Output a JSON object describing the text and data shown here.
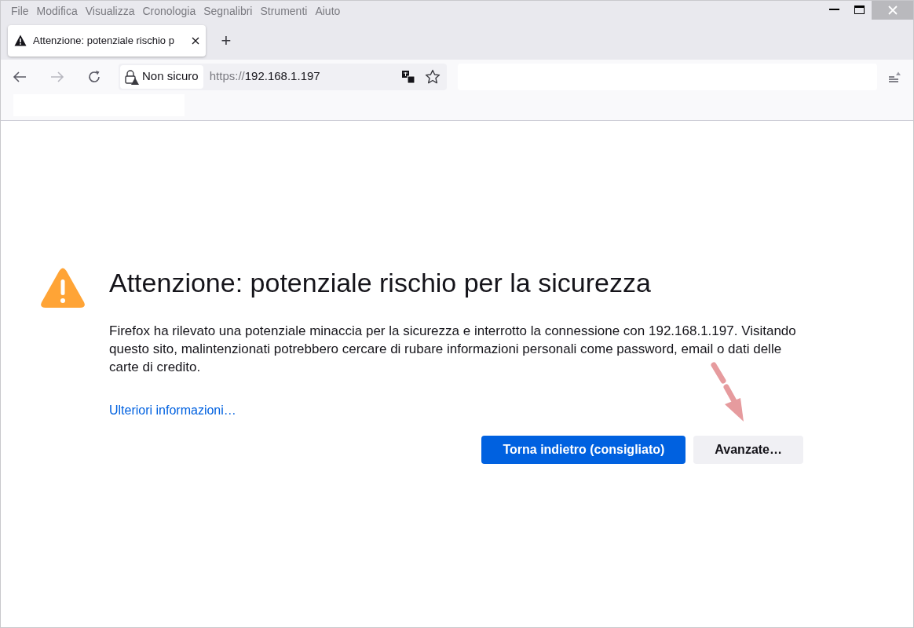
{
  "menu_bar": [
    {
      "label": "File"
    },
    {
      "label": "Modifica"
    },
    {
      "label": "Visualizza"
    },
    {
      "label": "Cronologia"
    },
    {
      "label": "Segnalibri"
    },
    {
      "label": "Strumenti"
    },
    {
      "label": "Aiuto"
    }
  ],
  "tabs": [
    {
      "title": "Attenzione: potenziale rischio p",
      "selected": true
    }
  ],
  "new_tab": "+",
  "address_bar": {
    "security_label": "Non sicuro",
    "url_scheme": "https://",
    "url_host": "192.168.1.197"
  },
  "page": {
    "heading": "Attenzione: potenziale rischio per la sicurezza",
    "message": "Firefox ha rilevato una potenziale minaccia per la sicurezza e interrotto la connessione con 192.168.1.197. Visitando questo sito, malintenzionati potrebbero cercare di rubare informazioni personali come password, email o dati delle carte di credito.",
    "link": "Ulteriori informazioni…",
    "buttons": [
      {
        "label": "Torna indietro (consigliato)",
        "kind": "primary"
      },
      {
        "label": "Avanzate…",
        "kind": "secondary"
      }
    ]
  }
}
